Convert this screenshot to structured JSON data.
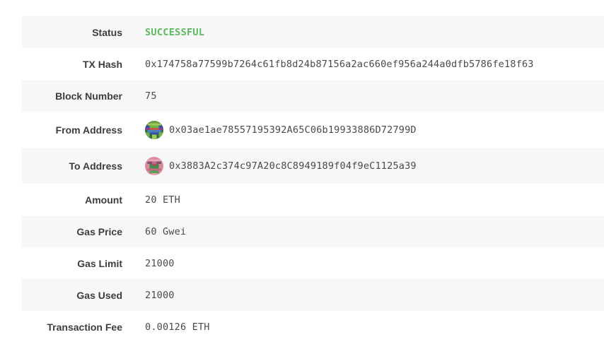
{
  "transaction": {
    "status": {
      "label": "Status",
      "value": "SUCCESSFUL",
      "color": "#5cb85c"
    },
    "tx_hash": {
      "label": "TX Hash",
      "value": "0x174758a77599b7264c61fb8d24b87156a2ac660ef956a244a0dfb5786fe18f63"
    },
    "block_number": {
      "label": "Block Number",
      "value": "75"
    },
    "from_address": {
      "label": "From Address",
      "value": "0x03ae1ae78557195392A65C06b19933886D72799D",
      "avatar_icon": "identicon-avatar-icon"
    },
    "to_address": {
      "label": "To Address",
      "value": "0x3883A2c374c97A20c8C8949189f04f9eC1125a39",
      "avatar_icon": "identicon-avatar-icon"
    },
    "amount": {
      "label": "Amount",
      "value": "20 ETH"
    },
    "gas_price": {
      "label": "Gas Price",
      "value": "60 Gwei"
    },
    "gas_limit": {
      "label": "Gas Limit",
      "value": "21000"
    },
    "gas_used": {
      "label": "Gas Used",
      "value": "21000"
    },
    "transaction_fee": {
      "label": "Transaction Fee",
      "value": "0.00126 ETH"
    }
  }
}
